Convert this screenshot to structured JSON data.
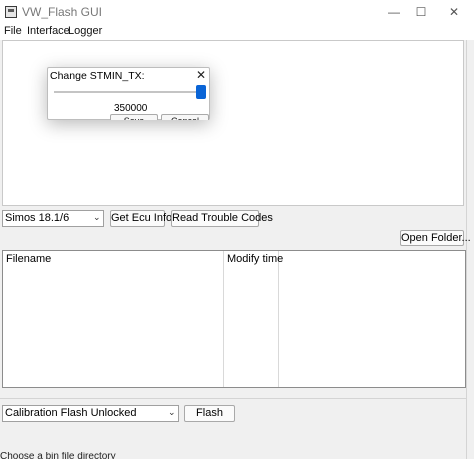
{
  "window": {
    "title": "VW_Flash GUI",
    "minimize_glyph": "—",
    "maximize_glyph": "☐",
    "close_glyph": "✕"
  },
  "menu": {
    "items": [
      {
        "label": "File"
      },
      {
        "label": "Interface"
      },
      {
        "label": "Logger"
      }
    ]
  },
  "dialog": {
    "title": "Change STMIN_TX:",
    "close_glyph": "✕",
    "value": "350000",
    "slider_fraction": 1.0,
    "save_label": "Save",
    "cancel_label": "Cancel"
  },
  "controls": {
    "ecu_selected": "Simos 18.1/6",
    "get_ecu_info_label": "Get Ecu Info",
    "read_dtc_label": "Read Trouble Codes",
    "open_folder_label": "Open Folder..."
  },
  "file_table": {
    "columns": [
      "Filename",
      "Modify time"
    ],
    "rows": []
  },
  "flash": {
    "mode_selected": "Calibration Flash Unlocked",
    "flash_label": "Flash"
  },
  "status": {
    "text": "Choose a bin file directory"
  },
  "colors": {
    "accent": "#0a64d6",
    "background": "#f0f0f0"
  }
}
